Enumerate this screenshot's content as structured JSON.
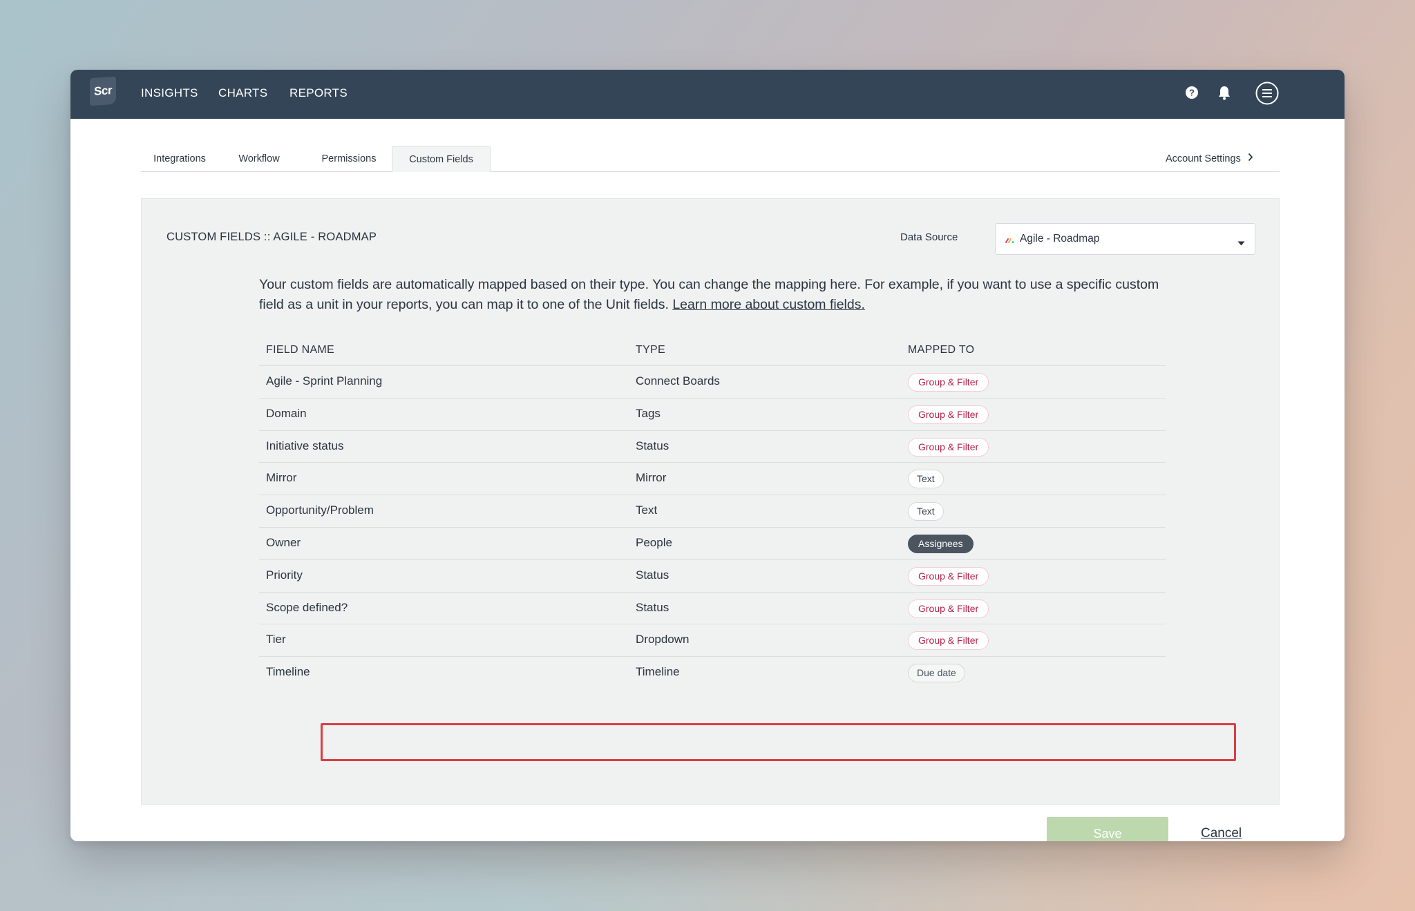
{
  "topbar": {
    "logo_text": "Scr",
    "nav": [
      "INSIGHTS",
      "CHARTS",
      "REPORTS"
    ],
    "icons": [
      "help-icon",
      "bell-icon",
      "menu-icon"
    ]
  },
  "tabs": {
    "items": [
      "Integrations",
      "Workflow",
      "Permissions",
      "Custom Fields"
    ],
    "active": "Custom Fields",
    "account_settings": "Account Settings"
  },
  "panel": {
    "title": "CUSTOM FIELDS :: AGILE - ROADMAP",
    "data_source_label": "Data Source",
    "data_source_value": "Agile - Roadmap",
    "description": "Your custom fields are automatically mapped based on their type. You can change the mapping here. For example, if you want to use a specific custom field as a unit in your reports, you can map it to one of the Unit fields.",
    "learn_more": "Learn more about custom fields."
  },
  "table": {
    "headers": [
      "FIELD NAME",
      "TYPE",
      "MAPPED TO"
    ],
    "rows": [
      {
        "field": "Agile - Sprint Planning",
        "type": "Connect Boards",
        "mapped": "Group & Filter"
      },
      {
        "field": "Domain",
        "type": "Tags",
        "mapped": "Group & Filter"
      },
      {
        "field": "Initiative status",
        "type": "Status",
        "mapped": "Group & Filter"
      },
      {
        "field": "Mirror",
        "type": "Mirror",
        "mapped": "Text"
      },
      {
        "field": "Opportunity/Problem",
        "type": "Text",
        "mapped": "Text"
      },
      {
        "field": "Owner",
        "type": "People",
        "mapped": "Assignees"
      },
      {
        "field": "Priority",
        "type": "Status",
        "mapped": "Group & Filter"
      },
      {
        "field": "Scope defined?",
        "type": "Status",
        "mapped": "Group & Filter"
      },
      {
        "field": "Tier",
        "type": "Dropdown",
        "mapped": "Group & Filter"
      },
      {
        "field": "Timeline",
        "type": "Timeline",
        "mapped": "Due date"
      }
    ]
  },
  "actions": {
    "save": "Save",
    "cancel": "Cancel"
  },
  "colors": {
    "topbar": "#344558",
    "group_filter_text": "#b32046",
    "save_disabled": "#bcd8ac",
    "highlight": "#dd3c44"
  }
}
